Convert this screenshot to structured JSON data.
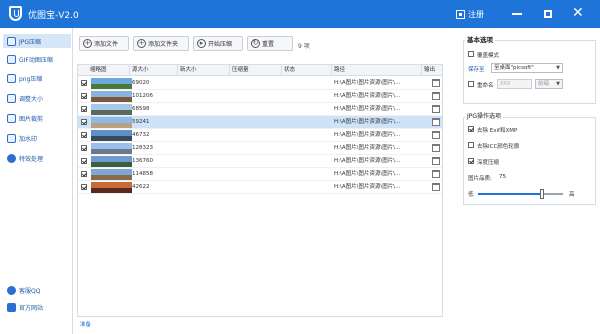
{
  "app": {
    "title": "优图宝-V2.0",
    "register": "注册"
  },
  "sidebar": {
    "items": [
      {
        "label": "JPG压缩",
        "active": true
      },
      {
        "label": "GIF动图压缩"
      },
      {
        "label": "png压缩"
      },
      {
        "label": "调整大小"
      },
      {
        "label": "图片裁剪"
      },
      {
        "label": "加水印"
      },
      {
        "label": "特效处理"
      }
    ],
    "bottom": [
      {
        "label": "客服QQ"
      },
      {
        "label": "官方网站"
      }
    ]
  },
  "toolbar": {
    "add_file": "添加文件",
    "add_folder": "添加文件夹",
    "start": "开始压缩",
    "reset": "重置",
    "count": "9 项"
  },
  "table": {
    "columns": [
      "缩略图",
      "源大小",
      "新大小",
      "压缩量",
      "状态",
      "路径",
      "输出"
    ],
    "rows": [
      {
        "size": "69020",
        "path": "H:\\A图片\\图片资源\\图片\\..."
      },
      {
        "size": "101206",
        "path": "H:\\A图片\\图片资源\\图片\\..."
      },
      {
        "size": "68598",
        "path": "H:\\A图片\\图片资源\\图片\\..."
      },
      {
        "size": "59241",
        "path": "H:\\A图片\\图片资源\\图片\\...",
        "selected": true
      },
      {
        "size": "46732",
        "path": "H:\\A图片\\图片资源\\图片\\..."
      },
      {
        "size": "128323",
        "path": "H:\\A图片\\图片资源\\图片\\..."
      },
      {
        "size": "136760",
        "path": "H:\\A图片\\图片资源\\图片\\..."
      },
      {
        "size": "114858",
        "path": "H:\\A图片\\图片资源\\图片\\..."
      },
      {
        "size": "42622",
        "path": "H:\\A图片\\图片资源\\图片\\..."
      }
    ]
  },
  "status": "准备",
  "panel": {
    "basic_title": "基本选项",
    "overwrite": "覆盖模式",
    "save_to": "保存至",
    "save_path": "至桌面\"picsoft\"",
    "rename": "重命名",
    "rename_placeholder": "XXX",
    "rename_option": "前缀",
    "jpg_title": "JPG操作选项",
    "opt_exif": "去除 Exif和XMP",
    "opt_icc": "去除ICC颜色轮廓",
    "opt_deep": "深度压缩",
    "quality_label": "图片品质:",
    "quality_value": "75",
    "low": "低",
    "high": "高",
    "quality_fraction": 0.75
  },
  "colors": {
    "accent": "#1E74D9",
    "selected_row": "#CFE3F8"
  }
}
